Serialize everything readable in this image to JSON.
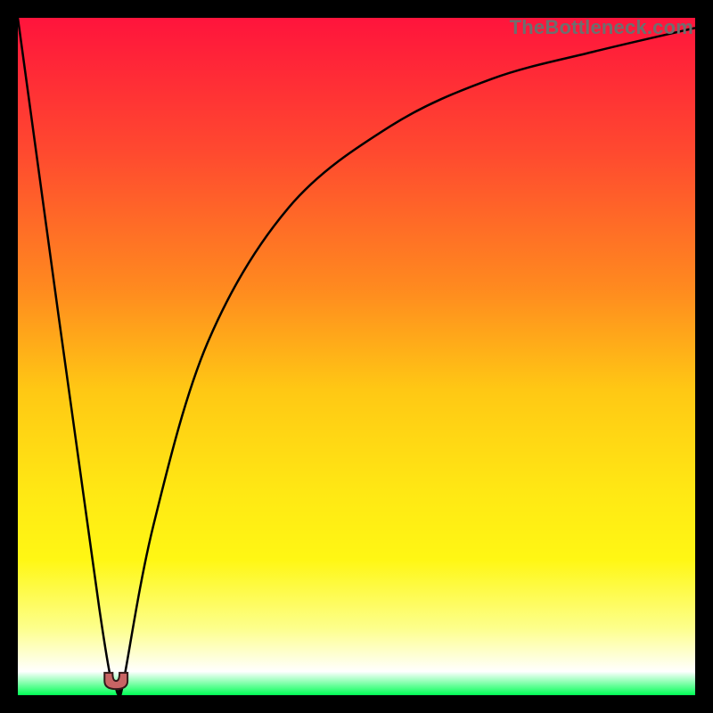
{
  "watermark": "TheBottleneck.com",
  "colors": {
    "frame": "#000000",
    "gradient_stops": [
      {
        "offset": 0,
        "color": "#ff143c"
      },
      {
        "offset": 0.2,
        "color": "#ff4a2f"
      },
      {
        "offset": 0.4,
        "color": "#ff8a1f"
      },
      {
        "offset": 0.55,
        "color": "#ffc814"
      },
      {
        "offset": 0.7,
        "color": "#ffe814"
      },
      {
        "offset": 0.8,
        "color": "#fff714"
      },
      {
        "offset": 0.9,
        "color": "#fdff8a"
      },
      {
        "offset": 0.965,
        "color": "#ffffff"
      },
      {
        "offset": 1.0,
        "color": "#00ff55"
      }
    ],
    "line": "#000000",
    "dip_fill": "#c86464",
    "dip_border": "#321919"
  },
  "chart_data": {
    "type": "line",
    "title": "",
    "xlabel": "",
    "ylabel": "",
    "xlim": [
      0,
      100
    ],
    "ylim": [
      0,
      100
    ],
    "x": [
      0,
      12,
      14.5,
      15,
      15.5,
      20,
      28,
      40,
      55,
      70,
      85,
      100
    ],
    "values": [
      100,
      13,
      1,
      1,
      1.5,
      25,
      52,
      72,
      84,
      91,
      95,
      98.5
    ],
    "dip_x_range": [
      12.8,
      16.2
    ],
    "dip_y": 1.5
  }
}
